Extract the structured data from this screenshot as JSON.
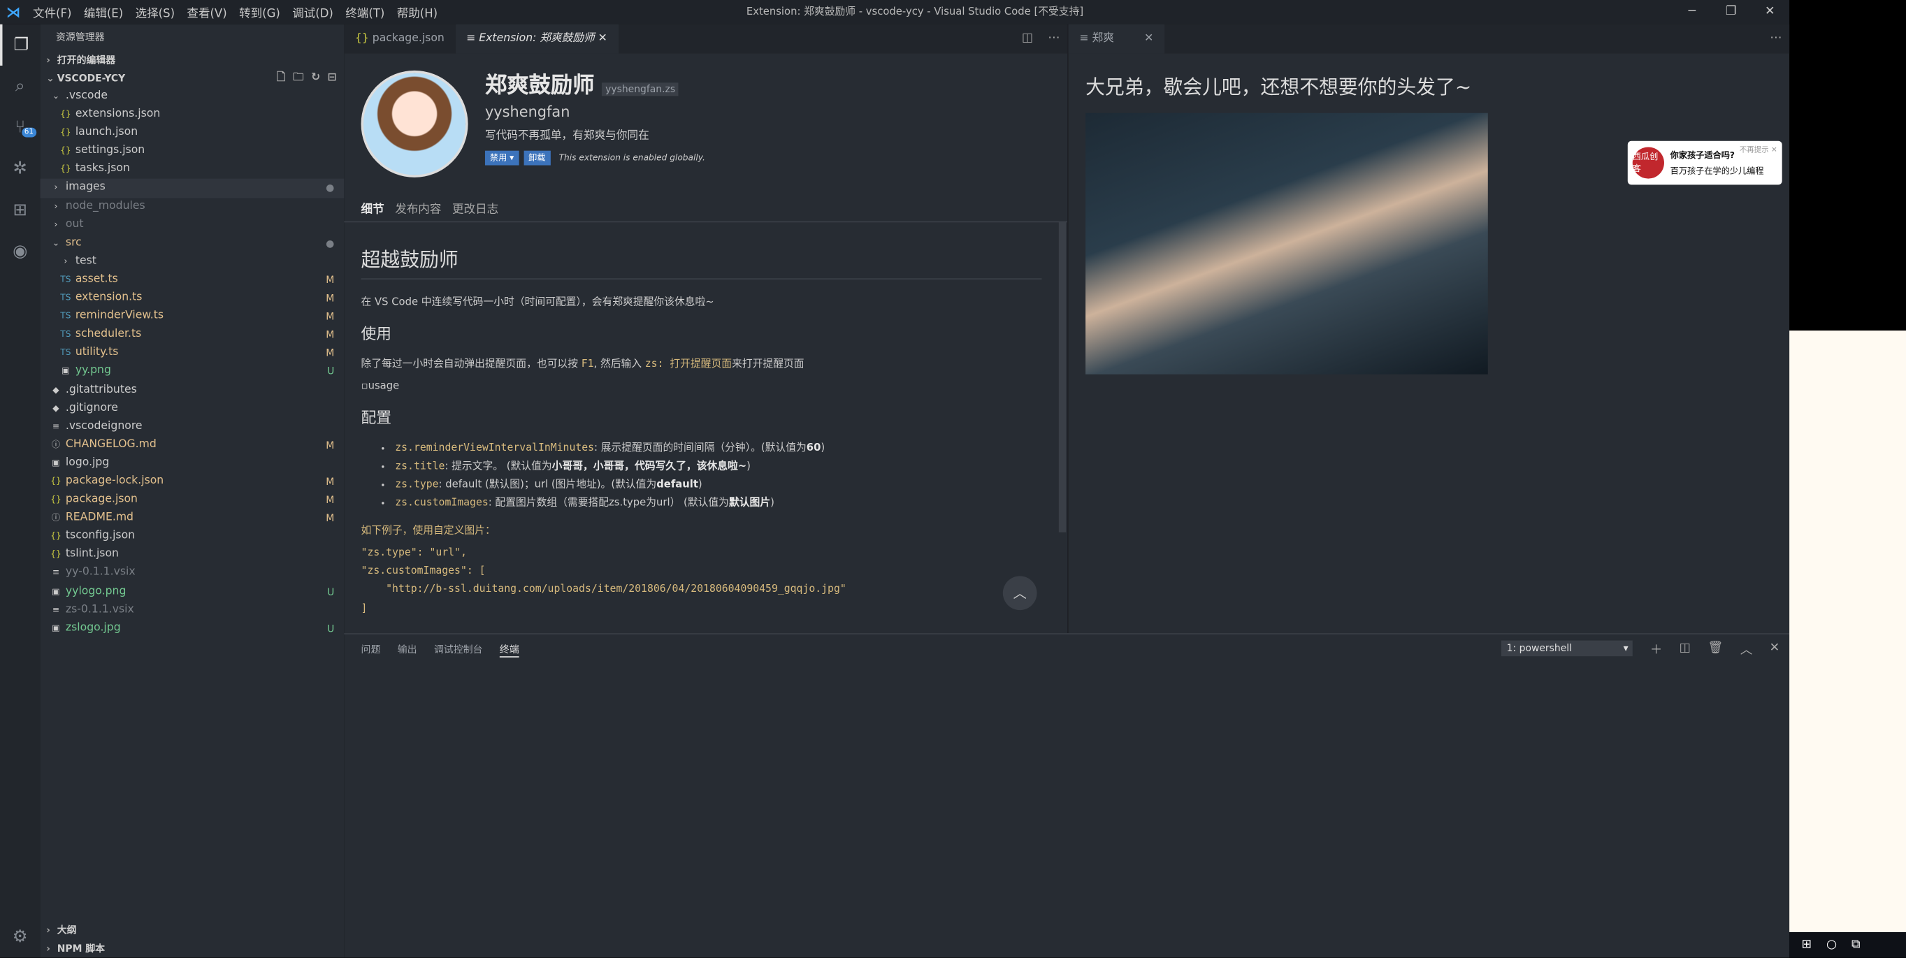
{
  "titlebar": {
    "menu": [
      "文件(F)",
      "编辑(E)",
      "选择(S)",
      "查看(V)",
      "转到(G)",
      "调试(D)",
      "终端(T)",
      "帮助(H)"
    ],
    "title": "Extension: 郑爽鼓励师 - vscode-ycy - Visual Studio Code [不受支持]"
  },
  "activity": {
    "scm_badge": "61"
  },
  "sidebar": {
    "title": "资源管理器",
    "open_editors": "打开的编辑器",
    "project": "VSCODE-YCY",
    "tree": [
      {
        "name": ".vscode",
        "kind": "folder-open",
        "depth": 1,
        "status": "",
        "color": "c-norm"
      },
      {
        "name": "extensions.json",
        "kind": "json",
        "depth": 2,
        "status": "",
        "color": "c-norm"
      },
      {
        "name": "launch.json",
        "kind": "json",
        "depth": 2,
        "status": "",
        "color": "c-norm"
      },
      {
        "name": "settings.json",
        "kind": "json",
        "depth": 2,
        "status": "",
        "color": "c-norm"
      },
      {
        "name": "tasks.json",
        "kind": "json",
        "depth": 2,
        "status": "",
        "color": "c-norm"
      },
      {
        "name": "images",
        "kind": "folder",
        "depth": 1,
        "status": "●",
        "color": "c-norm",
        "selected": true
      },
      {
        "name": "node_modules",
        "kind": "folder",
        "depth": 1,
        "status": "",
        "color": "c-ign"
      },
      {
        "name": "out",
        "kind": "folder",
        "depth": 1,
        "status": "",
        "color": "c-ign"
      },
      {
        "name": "src",
        "kind": "folder-open",
        "depth": 1,
        "status": "●",
        "color": "c-mod"
      },
      {
        "name": "test",
        "kind": "folder",
        "depth": 2,
        "status": "",
        "color": "c-norm"
      },
      {
        "name": "asset.ts",
        "kind": "ts",
        "depth": 2,
        "status": "M",
        "color": "c-mod"
      },
      {
        "name": "extension.ts",
        "kind": "ts",
        "depth": 2,
        "status": "M",
        "color": "c-mod"
      },
      {
        "name": "reminderView.ts",
        "kind": "ts",
        "depth": 2,
        "status": "M",
        "color": "c-mod"
      },
      {
        "name": "scheduler.ts",
        "kind": "ts",
        "depth": 2,
        "status": "M",
        "color": "c-mod"
      },
      {
        "name": "utility.ts",
        "kind": "ts",
        "depth": 2,
        "status": "M",
        "color": "c-mod"
      },
      {
        "name": "yy.png",
        "kind": "img",
        "depth": 2,
        "status": "U",
        "color": "c-untr"
      },
      {
        "name": ".gitattributes",
        "kind": "git",
        "depth": 1,
        "status": "",
        "color": "c-norm"
      },
      {
        "name": ".gitignore",
        "kind": "git",
        "depth": 1,
        "status": "",
        "color": "c-norm"
      },
      {
        "name": ".vscodeignore",
        "kind": "file",
        "depth": 1,
        "status": "",
        "color": "c-norm"
      },
      {
        "name": "CHANGELOG.md",
        "kind": "info",
        "depth": 1,
        "status": "M",
        "color": "c-mod"
      },
      {
        "name": "logo.jpg",
        "kind": "img",
        "depth": 1,
        "status": "",
        "color": "c-norm"
      },
      {
        "name": "package-lock.json",
        "kind": "json",
        "depth": 1,
        "status": "M",
        "color": "c-mod"
      },
      {
        "name": "package.json",
        "kind": "json",
        "depth": 1,
        "status": "M",
        "color": "c-mod"
      },
      {
        "name": "README.md",
        "kind": "info",
        "depth": 1,
        "status": "M",
        "color": "c-mod"
      },
      {
        "name": "tsconfig.json",
        "kind": "json",
        "depth": 1,
        "status": "",
        "color": "c-norm"
      },
      {
        "name": "tslint.json",
        "kind": "json",
        "depth": 1,
        "status": "",
        "color": "c-norm"
      },
      {
        "name": "yy-0.1.1.vsix",
        "kind": "file",
        "depth": 1,
        "status": "",
        "color": "c-ign"
      },
      {
        "name": "yylogo.png",
        "kind": "img",
        "depth": 1,
        "status": "U",
        "color": "c-untr"
      },
      {
        "name": "zs-0.1.1.vsix",
        "kind": "file",
        "depth": 1,
        "status": "",
        "color": "c-ign"
      },
      {
        "name": "zslogo.jpg",
        "kind": "img",
        "depth": 1,
        "status": "U",
        "color": "c-untr"
      }
    ],
    "outline": "大纲",
    "npm": "NPM 脚本"
  },
  "editor": {
    "tabs": [
      {
        "label": "package.json",
        "active": false
      },
      {
        "label": "Extension: 郑爽鼓励师",
        "active": true
      }
    ],
    "ext": {
      "name": "郑爽鼓励师",
      "id": "yyshengfan.zs",
      "publisher": "yyshengfan",
      "desc": "写代码不再孤单，有郑爽与你同在",
      "btn_disable": "禁用 ▾",
      "btn_uninstall": "卸载",
      "enabled": "This extension is enabled globally."
    },
    "nav": [
      "细节",
      "发布内容",
      "更改日志"
    ],
    "readme": {
      "h1": "超越鼓励师",
      "p1": "在 VS Code 中连续写代码一小时（时间可配置），会有郑爽提醒你该休息啦~",
      "h2_use": "使用",
      "p2_a": "除了每过一小时会自动弹出提醒页面，也可以按 ",
      "p2_key": "F1",
      "p2_b": ", 然后输入 ",
      "p2_cmd": "zs: 打开提醒页面",
      "p2_c": "来打开提醒页面",
      "img_alt": "usage",
      "h2_cfg": "配置",
      "items": [
        {
          "key": "zs.reminderViewIntervalInMinutes",
          "text": ": 展示提醒页面的时间间隔（分钟）。(默认值为",
          "def": "60",
          "end": ")"
        },
        {
          "key": "zs.title",
          "text": ": 提示文字。 (默认值为",
          "def": "小哥哥，小哥哥，代码写久了，该休息啦~",
          "end": ")"
        },
        {
          "key": "zs.type",
          "text": ": default (默认图)；url (图片地址)。(默认值为",
          "def": "default",
          "end": ")"
        },
        {
          "key": "zs.customImages",
          "text": ": 配置图片数组（需要搭配zs.type为url） (默认值为",
          "def": "默认图片",
          "end": ")"
        }
      ],
      "example_label": "如下例子，使用自定义图片：",
      "code": [
        "\"zs.type\": \"url\",",
        "\"zs.customImages\": [",
        "    \"http://b-ssl.duitang.com/uploads/item/201806/04/20180604090459_gqqjo.jpg\"",
        "]"
      ]
    }
  },
  "preview": {
    "tab": "郑爽",
    "title": "大兄弟，歇会儿吧，还想不想要你的头发了~"
  },
  "ad": {
    "title": "你家孩子适合吗?",
    "body": "百万孩子在学的少儿编程",
    "close_hint": "不再提示",
    "logo": "西瓜创客"
  },
  "panel": {
    "tabs": [
      "问题",
      "输出",
      "调试控制台",
      "终端"
    ],
    "active": "终端",
    "shell": "1: powershell"
  }
}
